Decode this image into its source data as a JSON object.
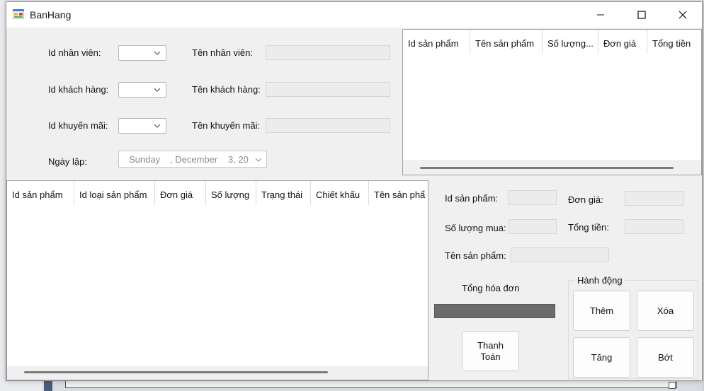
{
  "window": {
    "title": "BanHang",
    "controls": {
      "minimize": "—",
      "maximize": "☐",
      "close": "✕"
    }
  },
  "form": {
    "employee_id_label": "Id nhân viên:",
    "employee_name_label": "Tên nhân viên:",
    "employee_name_value": "",
    "customer_id_label": "Id khách hàng:",
    "customer_name_label": "Tên khách hàng:",
    "customer_name_value": "",
    "promo_id_label": "Id khuyến mãi:",
    "promo_name_label": "Tên khuyến mãi:",
    "promo_name_value": "",
    "date_label": "Ngày lập:",
    "date_weekday": "Sunday",
    "date_month": ", December",
    "date_day_year": "3, 20"
  },
  "cart_grid": {
    "columns": [
      "Id sản phẩm",
      "Tên sản phẩm",
      "Số lượng...",
      "Đơn giá",
      "Tổng tiền"
    ]
  },
  "products_grid": {
    "columns": [
      "Id sản phẩm",
      "Id loại sản phẩm",
      "Đơn giá",
      "Số lượng",
      "Trạng thái",
      "Chiết khấu",
      "Tên sản phẩ"
    ]
  },
  "detail": {
    "product_id_label": "Id sản phẩm:",
    "unit_price_label": "Đơn giá:",
    "quantity_label": "Số lượng mua:",
    "total_label": "Tổng tiền:",
    "product_name_label": "Tên sản phẩm:"
  },
  "invoice": {
    "total_label": "Tổng hóa đơn",
    "progress_fraction": 0.0,
    "pay_button_line1": "Thanh",
    "pay_button_line2": "Toán"
  },
  "actions": {
    "group_title": "Hành động",
    "add_label": "Thêm",
    "delete_label": "Xóa",
    "increase_label": "Tăng",
    "decrease_label": "Bớt"
  },
  "colors": {
    "window_bg": "#f0f0f0",
    "progress_track": "#6b6b6b",
    "progress_fill": "#06b025"
  }
}
